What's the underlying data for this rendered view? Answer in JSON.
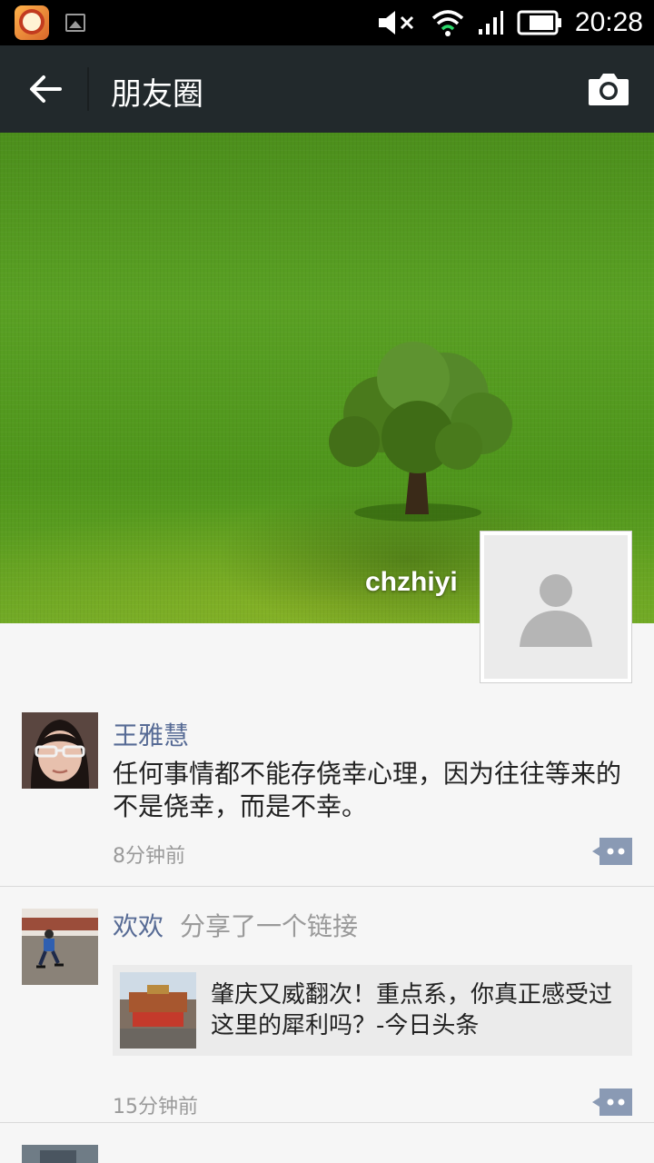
{
  "status_bar": {
    "time": "20:28",
    "icons": [
      "app-notification-icon",
      "gallery-icon",
      "mute-icon",
      "wifi-icon",
      "signal-icon",
      "battery-icon"
    ]
  },
  "header": {
    "title": "朋友圈",
    "back_icon": "back-arrow-icon",
    "camera_icon": "camera-icon",
    "background": "#22292c"
  },
  "cover": {
    "username": "chzhiyi"
  },
  "posts": [
    {
      "author": "王雅慧",
      "text": "任何事情都不能存侥幸心理，因为往往等来的不是侥幸，而是不幸。",
      "time": "8分钟前"
    },
    {
      "author": "欢欢",
      "action": "分享了一个链接",
      "link_title": "肇庆又威翻次！重点系，你真正感受过这里的犀利吗？-今日头条",
      "time": "15分钟前"
    }
  ],
  "colors": {
    "name_link": "#576b95",
    "comment_button": "#8a9ab4"
  }
}
